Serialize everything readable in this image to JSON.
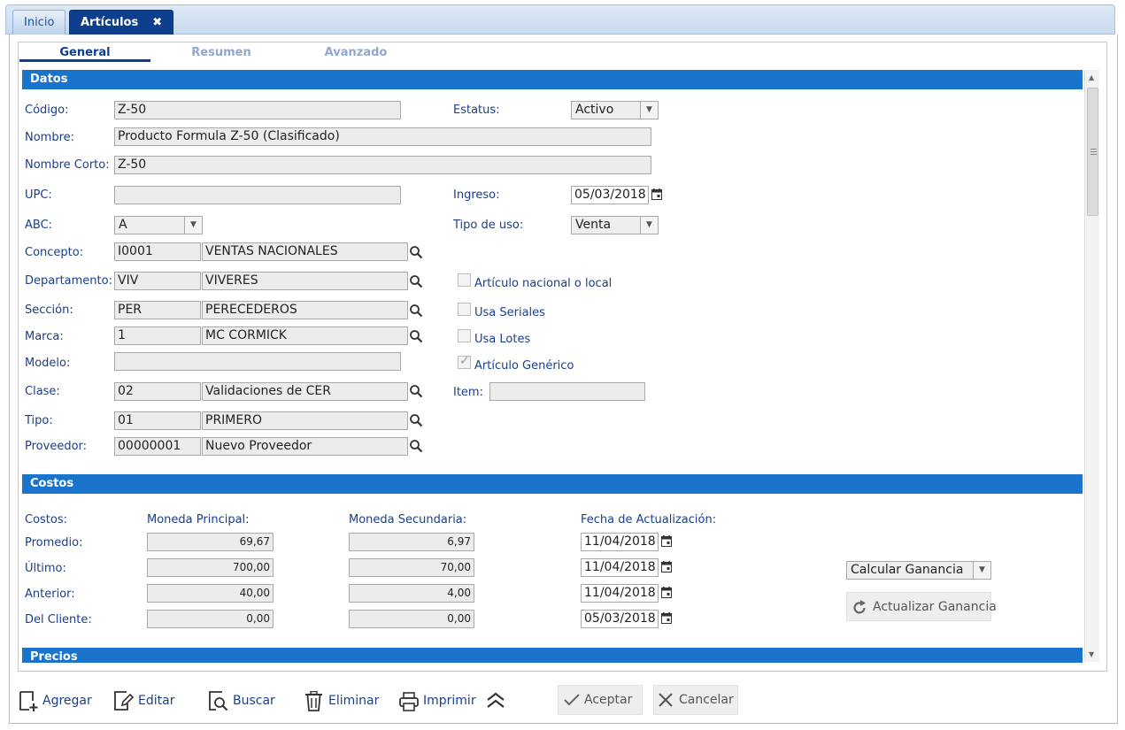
{
  "tabs": {
    "home": "Inicio",
    "articles": "Artículos",
    "close": "✖"
  },
  "subtabs": {
    "general": "General",
    "summary": "Resumen",
    "advanced": "Avanzado"
  },
  "sections": {
    "data": "Datos",
    "costs": "Costos",
    "prices": "Precios"
  },
  "fields": {
    "code_label": "Código:",
    "code": "Z-50",
    "status_label": "Estatus:",
    "status": "Activo",
    "name_label": "Nombre:",
    "name": "Producto Formula Z-50 (Clasificado)",
    "short_label": "Nombre Corto:",
    "short": "Z-50",
    "upc_label": "UPC:",
    "upc": "",
    "entry_label": "Ingreso:",
    "entry": "05/03/2018",
    "abc_label": "ABC:",
    "abc": "A",
    "use_label": "Tipo de uso:",
    "use": "Venta",
    "concept_label": "Concepto:",
    "concept_code": "I0001",
    "concept_desc": "VENTAS NACIONALES",
    "dept_label": "Departamento:",
    "dept_code": "VIV",
    "dept_desc": "VIVERES",
    "section_label": "Sección:",
    "section_code": "PER",
    "section_desc": "PERECEDEROS",
    "brand_label": "Marca:",
    "brand_code": "1",
    "brand_desc": "MC CORMICK",
    "model_label": "Modelo:",
    "model": "",
    "class_label": "Clase:",
    "class_code": "02",
    "class_desc": "Validaciones de CER",
    "type_label": "Tipo:",
    "type_code": "01",
    "type_desc": "PRIMERO",
    "supplier_label": "Proveedor:",
    "supplier_code": "00000001",
    "supplier_desc": "Nuevo Proveedor",
    "item_label": "Item:",
    "item": ""
  },
  "checks": {
    "national": {
      "label": "Artículo nacional o local",
      "checked": false
    },
    "serials": {
      "label": "Usa Seriales",
      "checked": false
    },
    "lots": {
      "label": "Usa Lotes",
      "checked": false
    },
    "generic": {
      "label": "Artículo Genérico",
      "checked": true
    }
  },
  "costs": {
    "col_costs": "Costos:",
    "col_main": "Moneda Principal:",
    "col_secondary": "Moneda Secundaria:",
    "col_date": "Fecha de Actualización:",
    "rows": [
      {
        "label": "Promedio:",
        "main": "69,67",
        "secondary": "6,97",
        "date": "11/04/2018"
      },
      {
        "label": "Último:",
        "main": "700,00",
        "secondary": "70,00",
        "date": "11/04/2018"
      },
      {
        "label": "Anterior:",
        "main": "40,00",
        "secondary": "4,00",
        "date": "11/04/2018"
      },
      {
        "label": "Del Cliente:",
        "main": "0,00",
        "secondary": "0,00",
        "date": "05/03/2018"
      }
    ],
    "calc_select": "Calcular Ganancia",
    "update_button": "Actualizar Ganancia"
  },
  "toolbar": {
    "add": "Agregar",
    "edit": "Editar",
    "search": "Buscar",
    "delete": "Eliminar",
    "print": "Imprimir",
    "accept": "Aceptar",
    "cancel": "Cancelar"
  },
  "colors": {
    "section_bg": "#1b74cc",
    "active_tab": "#0e3f8f",
    "label": "#1a3f8a"
  }
}
